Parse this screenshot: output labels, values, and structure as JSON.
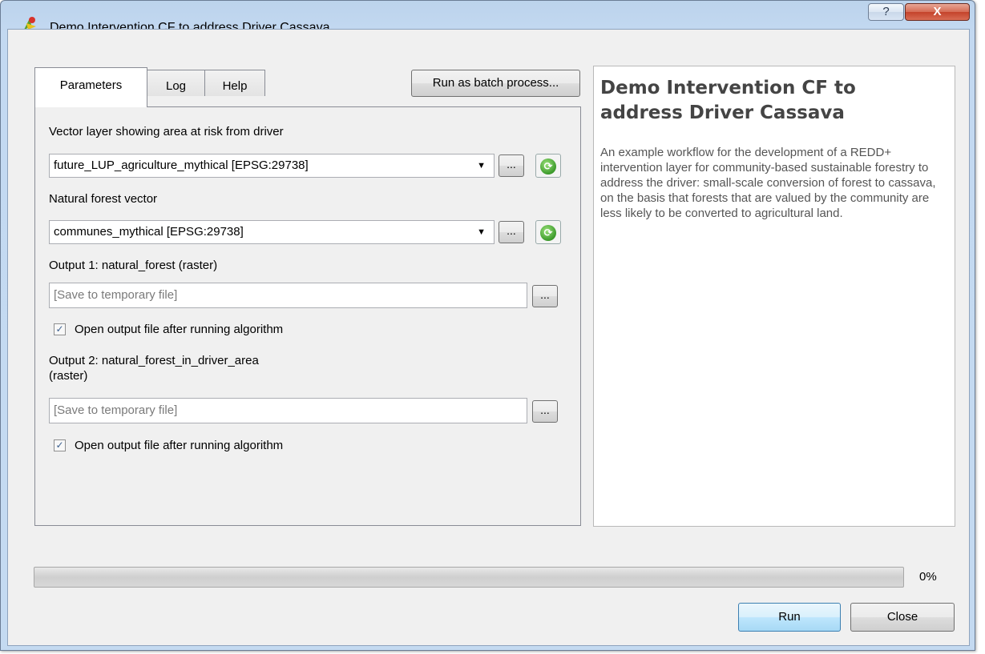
{
  "window": {
    "title": "Demo Intervention CF to address Driver Cassava",
    "help_glyph": "?",
    "close_glyph": "X"
  },
  "tabs": [
    {
      "label": "Parameters",
      "active": true
    },
    {
      "label": "Log",
      "active": false
    },
    {
      "label": "Help",
      "active": false
    }
  ],
  "batch_button": "Run as batch process...",
  "params": {
    "vector_label": "Vector layer showing area at risk from driver",
    "vector_value": "future_LUP_agriculture_mythical [EPSG:29738]",
    "forest_label": "Natural forest vector",
    "forest_value": "communes_mythical [EPSG:29738]",
    "browse_label": "...",
    "output1_label": "Output 1: natural_forest (raster)",
    "output1_placeholder": "[Save to temporary file]",
    "output1_checkbox": "Open output file after running algorithm",
    "output2_label_line1": "Output 2: natural_forest_in_driver_area",
    "output2_label_line2": "(raster)",
    "output2_placeholder": "[Save to temporary file]",
    "output2_checkbox": "Open output file after running algorithm",
    "check_glyph": "✓",
    "dropdown_glyph": "▼",
    "refresh_glyph": "⟳"
  },
  "description": {
    "title": "Demo Intervention CF to address Driver Cassava",
    "body": "An example workflow for the development of a REDD+ intervention layer for community-based sustainable forestry to address the driver: small-scale conversion of forest to cassava, on the basis that forests that are valued by the community are less likely to be converted to agricultural land."
  },
  "progress": {
    "value": 0,
    "label": "0%"
  },
  "buttons": {
    "run": "Run",
    "close": "Close"
  },
  "colors": {
    "progress_fill": "#37b44a",
    "title_close": "#c4432b"
  },
  "icons": {
    "app": "qgis-processing-icon",
    "refresh": "refresh-icon"
  }
}
